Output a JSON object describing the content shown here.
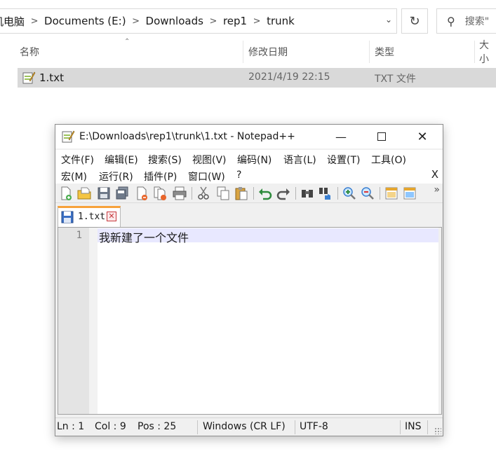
{
  "explorer": {
    "breadcrumbs": [
      "机电脑",
      "Documents (E:)",
      "Downloads",
      "rep1",
      "trunk"
    ],
    "search_placeholder": "搜索\"",
    "columns": {
      "name": "名称",
      "date": "修改日期",
      "type": "类型",
      "size": "大小"
    },
    "file": {
      "name": "1.txt",
      "date": "2021/4/19 22:15",
      "type": "TXT 文件"
    }
  },
  "notepad": {
    "title": "E:\\Downloads\\rep1\\trunk\\1.txt - Notepad++",
    "menu_row1": [
      "文件(F)",
      "编辑(E)",
      "搜索(S)",
      "视图(V)",
      "编码(N)",
      "语言(L)",
      "设置(T)",
      "工具(O)"
    ],
    "menu_row2": [
      "宏(M)",
      "运行(R)",
      "插件(P)",
      "窗口(W)",
      "?"
    ],
    "menu_close": "X",
    "toolbar_more": "»",
    "tab": {
      "label": "1.txt",
      "close": "✕"
    },
    "editor": {
      "line_number": "1",
      "text": "我新建了一个文件"
    },
    "status": {
      "ln": "Ln : 1",
      "col": "Col : 9",
      "pos": "Pos : 25",
      "eol": "Windows (CR LF)",
      "encoding": "UTF-8",
      "mode": "INS"
    },
    "colors": {
      "tab_accent": "#f7a23b",
      "current_line": "#e8e8ff"
    }
  }
}
